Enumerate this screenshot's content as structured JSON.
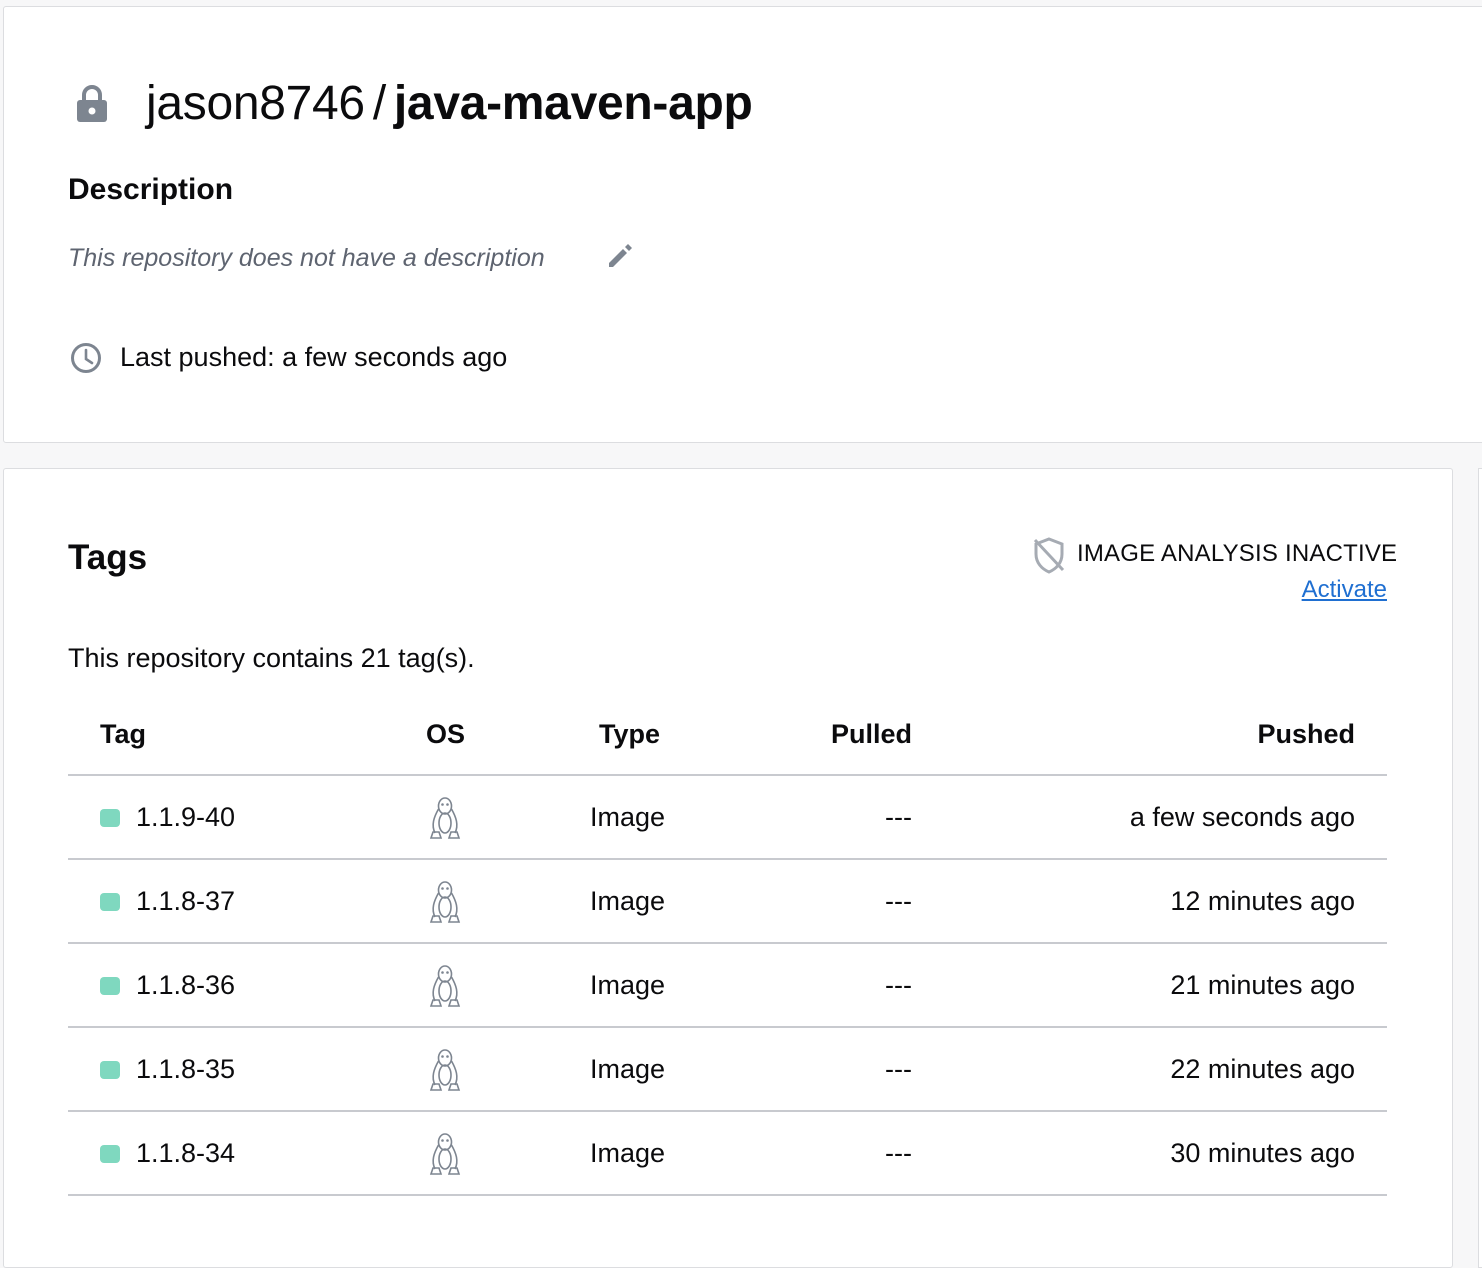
{
  "colors": {
    "accent_link": "#1f6fd1",
    "tag_status": "#7fd8bf",
    "icon_gray": "#7d8590"
  },
  "repo": {
    "owner": "jason8746",
    "separator": "/",
    "name": "java-maven-app",
    "visibility_icon": "lock-icon",
    "description_heading": "Description",
    "description_placeholder": "This repository does not have a description",
    "edit_icon": "pencil-icon",
    "last_pushed": "Last pushed: a few seconds ago"
  },
  "tags": {
    "heading": "Tags",
    "analysis_status": "IMAGE ANALYSIS INACTIVE",
    "analysis_icon": "shield-off-icon",
    "activate_label": "Activate",
    "count_text": "This repository contains 21 tag(s).",
    "columns": [
      "Tag",
      "OS",
      "Type",
      "Pulled",
      "Pushed"
    ],
    "rows": [
      {
        "tag": "1.1.9-40",
        "os": "linux-icon",
        "type": "Image",
        "pulled": "---",
        "pushed": "a few seconds ago"
      },
      {
        "tag": "1.1.8-37",
        "os": "linux-icon",
        "type": "Image",
        "pulled": "---",
        "pushed": "12 minutes ago"
      },
      {
        "tag": "1.1.8-36",
        "os": "linux-icon",
        "type": "Image",
        "pulled": "---",
        "pushed": "21 minutes ago"
      },
      {
        "tag": "1.1.8-35",
        "os": "linux-icon",
        "type": "Image",
        "pulled": "---",
        "pushed": "22 minutes ago"
      },
      {
        "tag": "1.1.8-34",
        "os": "linux-icon",
        "type": "Image",
        "pulled": "---",
        "pushed": "30 minutes ago"
      }
    ]
  }
}
